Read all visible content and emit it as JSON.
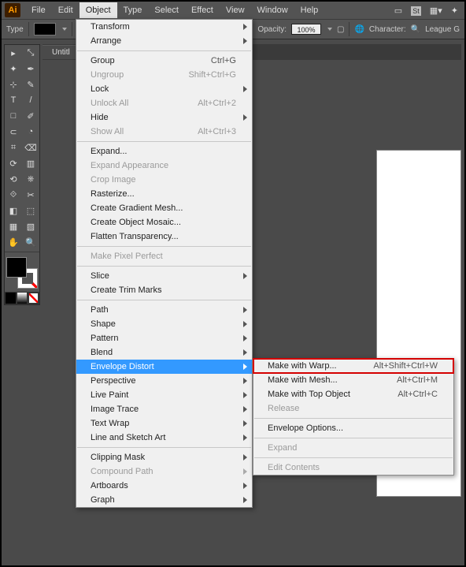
{
  "menubar": {
    "logo": "Ai",
    "items": [
      "File",
      "Edit",
      "Object",
      "Type",
      "Select",
      "Effect",
      "View",
      "Window",
      "Help"
    ],
    "open_index": 2
  },
  "optbar": {
    "type_label": "Type",
    "opacity_label": "Opacity:",
    "opacity_value": "100%",
    "character_label": "Character:",
    "font_name": "League G"
  },
  "tab": {
    "title": "Untitl"
  },
  "tool_glyphs": [
    "▸",
    "⤡",
    "✦",
    "✒",
    "⊹",
    "✎",
    "T",
    "/",
    "□",
    "✐",
    "⊂",
    "◔",
    "⌗",
    "⌫",
    "⟳",
    "▥",
    "⟲",
    "⎈",
    "⟐",
    "✂",
    "◧",
    "⬚",
    "▦",
    "▧",
    "✋",
    "🔍"
  ],
  "object_menu": [
    {
      "label": "Transform",
      "sub": true
    },
    {
      "label": "Arrange",
      "sub": true
    },
    {
      "sep": true
    },
    {
      "label": "Group",
      "shortcut": "Ctrl+G"
    },
    {
      "label": "Ungroup",
      "shortcut": "Shift+Ctrl+G",
      "disabled": true
    },
    {
      "label": "Lock",
      "sub": true
    },
    {
      "label": "Unlock All",
      "shortcut": "Alt+Ctrl+2",
      "disabled": true
    },
    {
      "label": "Hide",
      "sub": true
    },
    {
      "label": "Show All",
      "shortcut": "Alt+Ctrl+3",
      "disabled": true
    },
    {
      "sep": true
    },
    {
      "label": "Expand..."
    },
    {
      "label": "Expand Appearance",
      "disabled": true
    },
    {
      "label": "Crop Image",
      "disabled": true
    },
    {
      "label": "Rasterize..."
    },
    {
      "label": "Create Gradient Mesh..."
    },
    {
      "label": "Create Object Mosaic..."
    },
    {
      "label": "Flatten Transparency..."
    },
    {
      "sep": true
    },
    {
      "label": "Make Pixel Perfect",
      "disabled": true
    },
    {
      "sep": true
    },
    {
      "label": "Slice",
      "sub": true
    },
    {
      "label": "Create Trim Marks"
    },
    {
      "sep": true
    },
    {
      "label": "Path",
      "sub": true
    },
    {
      "label": "Shape",
      "sub": true
    },
    {
      "label": "Pattern",
      "sub": true
    },
    {
      "label": "Blend",
      "sub": true
    },
    {
      "label": "Envelope Distort",
      "sub": true,
      "highlight": true
    },
    {
      "label": "Perspective",
      "sub": true
    },
    {
      "label": "Live Paint",
      "sub": true
    },
    {
      "label": "Image Trace",
      "sub": true
    },
    {
      "label": "Text Wrap",
      "sub": true
    },
    {
      "label": "Line and Sketch Art",
      "sub": true
    },
    {
      "sep": true
    },
    {
      "label": "Clipping Mask",
      "sub": true
    },
    {
      "label": "Compound Path",
      "sub": true,
      "disabled": true
    },
    {
      "label": "Artboards",
      "sub": true
    },
    {
      "label": "Graph",
      "sub": true
    }
  ],
  "submenu": [
    {
      "label": "Make with Warp...",
      "shortcut": "Alt+Shift+Ctrl+W",
      "boxed": true
    },
    {
      "label": "Make with Mesh...",
      "shortcut": "Alt+Ctrl+M"
    },
    {
      "label": "Make with Top Object",
      "shortcut": "Alt+Ctrl+C"
    },
    {
      "label": "Release",
      "disabled": true
    },
    {
      "sep": true
    },
    {
      "label": "Envelope Options..."
    },
    {
      "sep": true
    },
    {
      "label": "Expand",
      "disabled": true
    },
    {
      "sep": true
    },
    {
      "label": "Edit Contents",
      "disabled": true
    }
  ]
}
